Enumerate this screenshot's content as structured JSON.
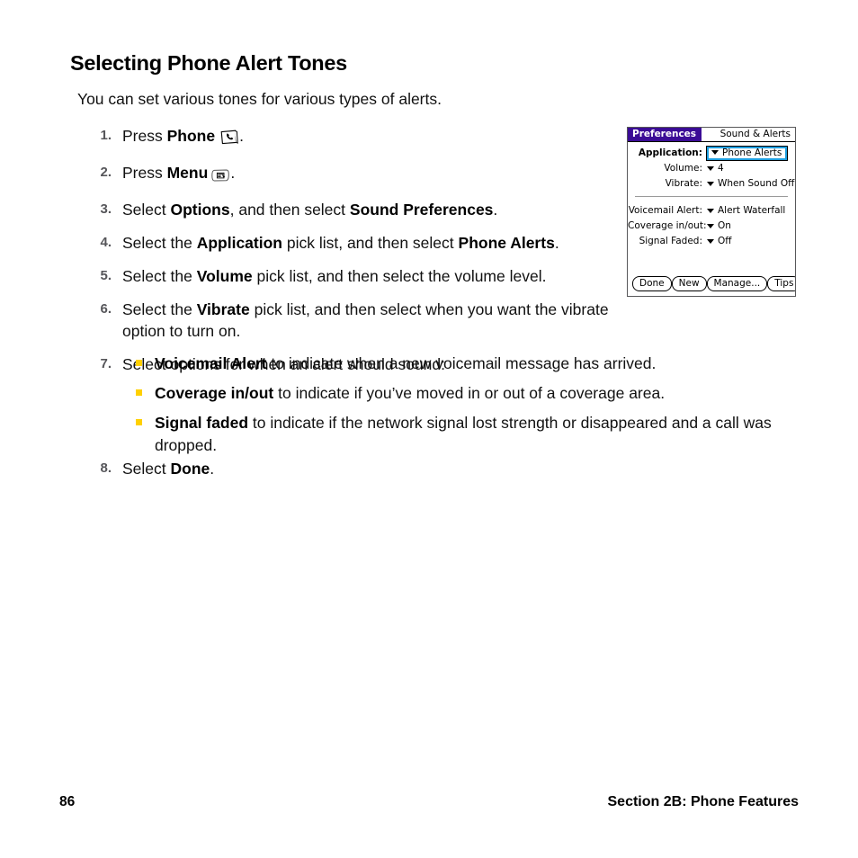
{
  "page": {
    "title": "Selecting Phone Alert Tones",
    "intro": "You can set various tones for various types of alerts."
  },
  "steps": [
    {
      "num": "1.",
      "pre": "Press ",
      "bold": "Phone",
      "icon": "phone-key-icon",
      "post": "."
    },
    {
      "num": "2.",
      "pre": "Press ",
      "bold": "Menu",
      "icon": "menu-key-icon",
      "post": "."
    },
    {
      "num": "3.",
      "pre": "Select ",
      "bold": "Options",
      "mid": ", and then select ",
      "bold2": "Sound Preferences",
      "post": "."
    },
    {
      "num": "4.",
      "pre": "Select the ",
      "bold": "Application",
      "mid": " pick list, and then select ",
      "bold2": "Phone Alerts",
      "post": "."
    },
    {
      "num": "5.",
      "pre": "Select the ",
      "bold": "Volume",
      "mid": " pick list, and then select the volume level.",
      "post": ""
    },
    {
      "num": "6.",
      "pre": "Select the ",
      "bold": "Vibrate",
      "mid": " pick list, and then select when you want the vibrate option to turn on.",
      "post": ""
    },
    {
      "num": "7.",
      "pre": "Select options for when an alert should sound:",
      "bold": "",
      "post": ""
    }
  ],
  "step_texts": {
    "s1_pre": "Press ",
    "s1_bold": "Phone",
    "s1_post": ".",
    "s2_pre": "Press ",
    "s2_bold": "Menu",
    "s2_post": ".",
    "s3_pre": "Select ",
    "s3_bold": "Options",
    "s3_mid": ", and then select ",
    "s3_bold2": "Sound Preferences",
    "s3_post": ".",
    "s4_pre": "Select the ",
    "s4_bold": "Application",
    "s4_mid": " pick list, and then select ",
    "s4_bold2": "Phone Alerts",
    "s4_post": ".",
    "s5_pre": "Select the ",
    "s5_bold": "Volume",
    "s5_mid": " pick list, and then select the volume level.",
    "s6_pre": "Select the ",
    "s6_bold": "Vibrate",
    "s6_mid": " pick list, and then select when you want the vibrate option to turn on.",
    "s7_text": "Select options for when an alert should sound:",
    "s8_pre": "Select ",
    "s8_bold": "Done",
    "s8_post": "."
  },
  "step_numbers": {
    "n1": "1.",
    "n2": "2.",
    "n3": "3.",
    "n4": "4.",
    "n5": "5.",
    "n6": "6.",
    "n7": "7.",
    "n8": "8."
  },
  "sublist": [
    {
      "bold": "Voicemail Alert",
      "text": " to indicate when a new voicemail message has arrived."
    },
    {
      "bold": "Coverage in/out",
      "text": " to indicate if you’ve moved in or out of a coverage area."
    },
    {
      "bold": "Signal faded",
      "text": " to indicate if the network signal lost strength or disappeared and a call was dropped."
    }
  ],
  "device_screenshot": {
    "titlebar": {
      "tab_label": "Preferences",
      "right_label": "Sound & Alerts",
      "tab_color": "#3b0c96"
    },
    "rows": [
      {
        "label": "Application:",
        "value": "Phone Alerts",
        "highlighted": true
      },
      {
        "label": "Volume:",
        "value": "4",
        "highlighted": false
      },
      {
        "label": "Vibrate:",
        "value": "When Sound Off",
        "highlighted": false
      }
    ],
    "rows2": [
      {
        "label": "Voicemail Alert:",
        "value": "Alert Waterfall"
      },
      {
        "label": "Coverage in/out:",
        "value": "On"
      },
      {
        "label": "Signal Faded:",
        "value": "Off"
      }
    ],
    "buttons": [
      "Done",
      "New",
      "Manage...",
      "Tips"
    ],
    "highlight_color": "#1e9fe0"
  },
  "footer": {
    "page_number": "86",
    "section": "Section 2B: Phone Features"
  },
  "colors": {
    "bullet": "#ffd000",
    "step_number": "#56565a"
  }
}
